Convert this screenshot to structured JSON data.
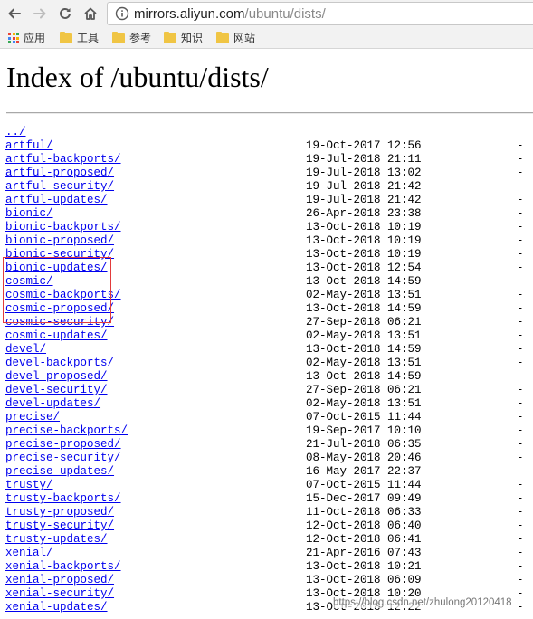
{
  "browser": {
    "url_host": "mirrors.aliyun.com",
    "url_path": "/ubuntu/dists/",
    "bookmarks": [
      {
        "label": "应用",
        "icon": "apps-grid-icon"
      },
      {
        "label": "工具",
        "icon": "folder-icon"
      },
      {
        "label": "参考",
        "icon": "folder-icon"
      },
      {
        "label": "知识",
        "icon": "folder-icon"
      },
      {
        "label": "网站",
        "icon": "folder-icon"
      }
    ]
  },
  "page": {
    "title": "Index of /ubuntu/dists/",
    "entries": [
      {
        "name": "../",
        "date": "",
        "size": ""
      },
      {
        "name": "artful/",
        "date": "19-Oct-2017 12:56",
        "size": "-"
      },
      {
        "name": "artful-backports/",
        "date": "19-Jul-2018 21:11",
        "size": "-"
      },
      {
        "name": "artful-proposed/",
        "date": "19-Jul-2018 13:02",
        "size": "-"
      },
      {
        "name": "artful-security/",
        "date": "19-Jul-2018 21:42",
        "size": "-"
      },
      {
        "name": "artful-updates/",
        "date": "19-Jul-2018 21:42",
        "size": "-"
      },
      {
        "name": "bionic/",
        "date": "26-Apr-2018 23:38",
        "size": "-"
      },
      {
        "name": "bionic-backports/",
        "date": "13-Oct-2018 10:19",
        "size": "-"
      },
      {
        "name": "bionic-proposed/",
        "date": "13-Oct-2018 10:19",
        "size": "-"
      },
      {
        "name": "bionic-security/",
        "date": "13-Oct-2018 10:19",
        "size": "-"
      },
      {
        "name": "bionic-updates/",
        "date": "13-Oct-2018 12:54",
        "size": "-"
      },
      {
        "name": "cosmic/",
        "date": "13-Oct-2018 14:59",
        "size": "-"
      },
      {
        "name": "cosmic-backports/",
        "date": "02-May-2018 13:51",
        "size": "-"
      },
      {
        "name": "cosmic-proposed/",
        "date": "13-Oct-2018 14:59",
        "size": "-"
      },
      {
        "name": "cosmic-security/",
        "date": "27-Sep-2018 06:21",
        "size": "-"
      },
      {
        "name": "cosmic-updates/",
        "date": "02-May-2018 13:51",
        "size": "-"
      },
      {
        "name": "devel/",
        "date": "13-Oct-2018 14:59",
        "size": "-"
      },
      {
        "name": "devel-backports/",
        "date": "02-May-2018 13:51",
        "size": "-"
      },
      {
        "name": "devel-proposed/",
        "date": "13-Oct-2018 14:59",
        "size": "-"
      },
      {
        "name": "devel-security/",
        "date": "27-Sep-2018 06:21",
        "size": "-"
      },
      {
        "name": "devel-updates/",
        "date": "02-May-2018 13:51",
        "size": "-"
      },
      {
        "name": "precise/",
        "date": "07-Oct-2015 11:44",
        "size": "-"
      },
      {
        "name": "precise-backports/",
        "date": "19-Sep-2017 10:10",
        "size": "-"
      },
      {
        "name": "precise-proposed/",
        "date": "21-Jul-2018 06:35",
        "size": "-"
      },
      {
        "name": "precise-security/",
        "date": "08-May-2018 20:46",
        "size": "-"
      },
      {
        "name": "precise-updates/",
        "date": "16-May-2017 22:37",
        "size": "-"
      },
      {
        "name": "trusty/",
        "date": "07-Oct-2015 11:44",
        "size": "-"
      },
      {
        "name": "trusty-backports/",
        "date": "15-Dec-2017 09:49",
        "size": "-"
      },
      {
        "name": "trusty-proposed/",
        "date": "11-Oct-2018 06:33",
        "size": "-"
      },
      {
        "name": "trusty-security/",
        "date": "12-Oct-2018 06:40",
        "size": "-"
      },
      {
        "name": "trusty-updates/",
        "date": "12-Oct-2018 06:41",
        "size": "-"
      },
      {
        "name": "xenial/",
        "date": "21-Apr-2016 07:43",
        "size": "-"
      },
      {
        "name": "xenial-backports/",
        "date": "13-Oct-2018 10:21",
        "size": "-"
      },
      {
        "name": "xenial-proposed/",
        "date": "13-Oct-2018 06:09",
        "size": "-"
      },
      {
        "name": "xenial-security/",
        "date": "13-Oct-2018 10:20",
        "size": "-"
      },
      {
        "name": "xenial-updates/",
        "date": "13-Oct-2018 12:22",
        "size": "-"
      }
    ]
  },
  "watermark": "https://blog.csdn.net/zhulong20120418",
  "colors": {
    "link": "#0000ee",
    "highlight_border": "#e23b3b",
    "folder": "#f0c544"
  }
}
